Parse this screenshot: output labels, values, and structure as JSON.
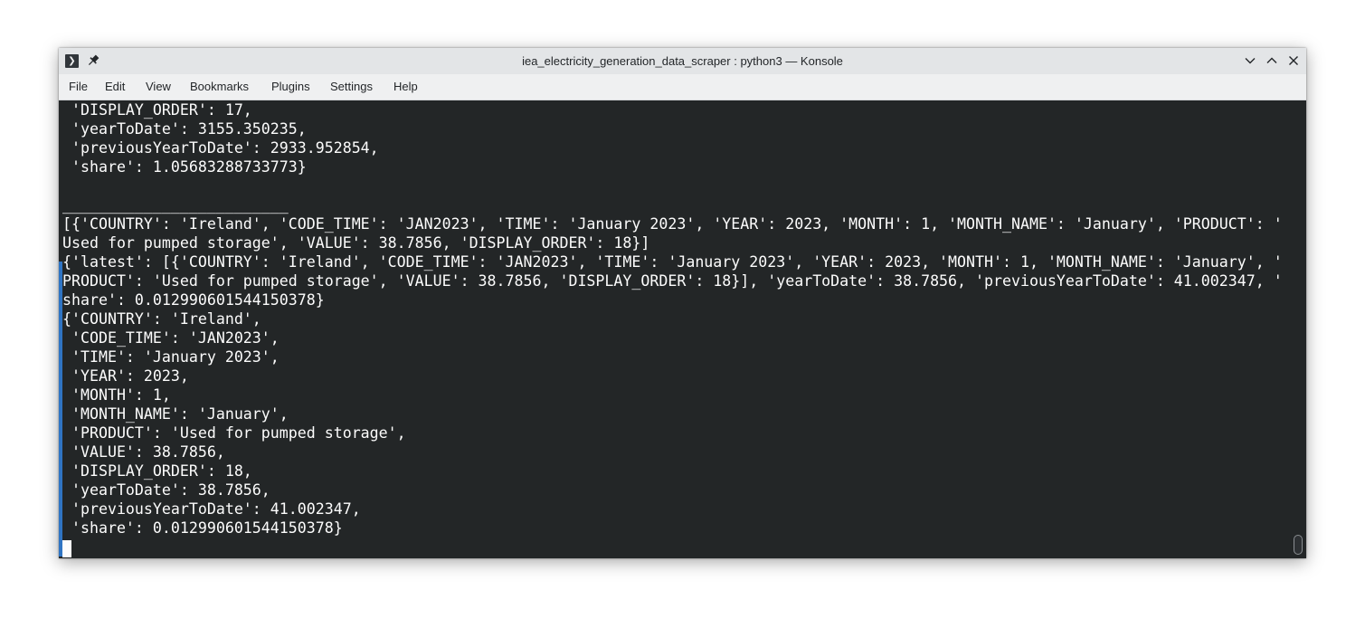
{
  "window": {
    "title": "iea_electricity_generation_data_scraper : python3 — Konsole"
  },
  "menu": {
    "items": [
      "File",
      "Edit",
      "View",
      "Bookmarks",
      "Plugins",
      "Settings",
      "Help"
    ]
  },
  "terminal": {
    "lines": [
      " 'DISPLAY_ORDER': 17,",
      " 'yearToDate': 3155.350235,",
      " 'previousYearToDate': 2933.952854,",
      " 'share': 1.05683288733773}",
      "",
      "_________________________",
      "[{'COUNTRY': 'Ireland', 'CODE_TIME': 'JAN2023', 'TIME': 'January 2023', 'YEAR': 2023, 'MONTH': 1, 'MONTH_NAME': 'January', 'PRODUCT': '",
      "Used for pumped storage', 'VALUE': 38.7856, 'DISPLAY_ORDER': 18}]",
      "{'latest': [{'COUNTRY': 'Ireland', 'CODE_TIME': 'JAN2023', 'TIME': 'January 2023', 'YEAR': 2023, 'MONTH': 1, 'MONTH_NAME': 'January', '",
      "PRODUCT': 'Used for pumped storage', 'VALUE': 38.7856, 'DISPLAY_ORDER': 18}], 'yearToDate': 38.7856, 'previousYearToDate': 41.002347, '",
      "share': 0.012990601544150378}",
      "{'COUNTRY': 'Ireland',",
      " 'CODE_TIME': 'JAN2023',",
      " 'TIME': 'January 2023',",
      " 'YEAR': 2023,",
      " 'MONTH': 1,",
      " 'MONTH_NAME': 'January',",
      " 'PRODUCT': 'Used for pumped storage',",
      " 'VALUE': 38.7856,",
      " 'DISPLAY_ORDER': 18,",
      " 'yearToDate': 38.7856,",
      " 'previousYearToDate': 41.002347,",
      " 'share': 0.012990601544150378}",
      "",
      "_________________________"
    ]
  },
  "colors": {
    "terminal_bg": "#232627",
    "terminal_fg": "#fcfcfc",
    "accent": "#2f74c3",
    "titlebar_bg": "#e3e5e7",
    "menubar_bg": "#eff0f1"
  },
  "icons": {
    "app": "konsole-icon",
    "pin": "pin-icon",
    "minimize": "chevron-down-icon",
    "maximize": "chevron-up-icon",
    "close": "close-icon"
  }
}
